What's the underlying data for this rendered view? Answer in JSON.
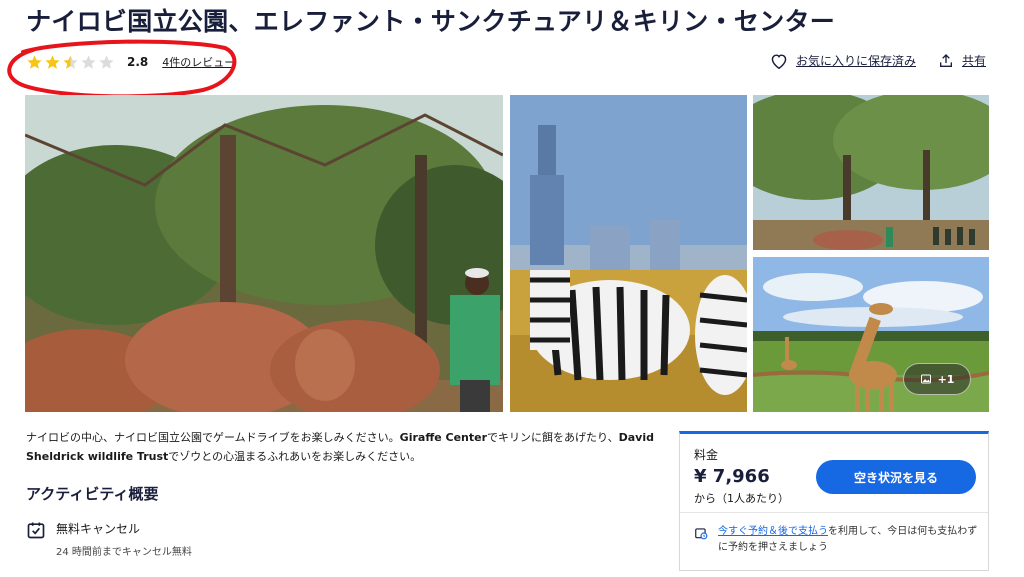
{
  "header": {
    "title": "ナイロビ国立公園、エレファント・サンクチュアリ＆キリン・センター",
    "rating": 2.8,
    "rating_text": "2.8",
    "reviews_link": "4件のレビュー",
    "save_label": "お気に入りに保存済み",
    "share_label": "共有"
  },
  "gallery": {
    "more_badge": "+1",
    "photos": [
      "elephants-with-keeper",
      "zebras-with-city-skyline",
      "savanna-trees-with-people",
      "giraffe-in-grassland"
    ]
  },
  "description": {
    "part1": "ナイロビの中心、ナイロビ国立公園でゲームドライブをお楽しみください。",
    "bold1": "Giraffe Center",
    "part2": "でキリンに餌をあげたり、",
    "bold2": "David Sheldrick wildlife Trust",
    "part3": "でゾウとの心温まるふれあいをお楽しみください。"
  },
  "overview": {
    "title": "アクティビティ概要",
    "cancel_label": "無料キャンセル",
    "cancel_sub": "24 時間前までキャンセル無料"
  },
  "price": {
    "label": "料金",
    "value": "¥ 7,966",
    "note": "から（1人あたり）",
    "cta": "空き状況を見る",
    "paylater_link": "今すぐ予約＆後で支払う",
    "paylater_text": "を利用して、今日は何も支払わずに予約を押さえましょう"
  },
  "colors": {
    "accent": "#1668e3",
    "star": "#f5c518",
    "annotation": "#e8141c"
  }
}
